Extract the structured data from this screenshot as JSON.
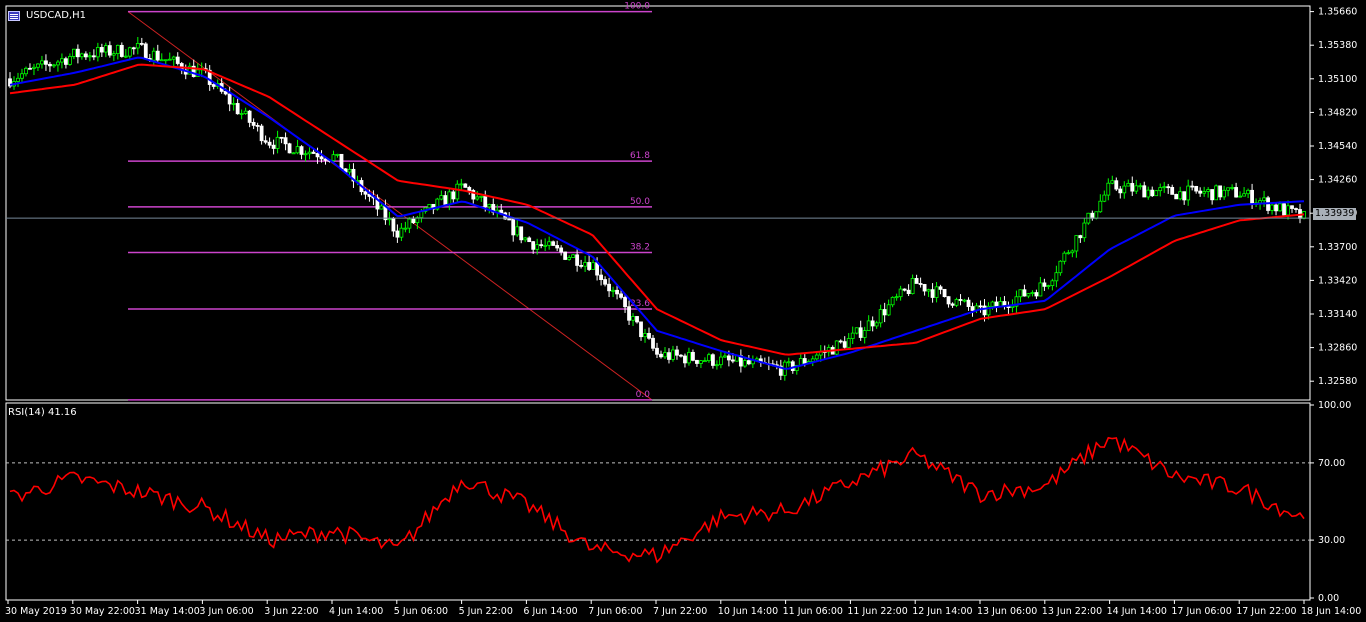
{
  "window": {
    "symbol_label": "USDCAD,H1",
    "current_price": "1.33939"
  },
  "colors": {
    "background": "#000000",
    "frame": "#ffffff",
    "candle_up": "#00ff00",
    "candle_down": "#ffffff",
    "ma_fast": "#0000ff",
    "ma_slow": "#ff0000",
    "fib": "#cc44cc",
    "rsi": "#ff0000",
    "bid_line": "#778899"
  },
  "price_axis": {
    "ticks": [
      "1.35660",
      "1.35380",
      "1.35100",
      "1.34820",
      "1.34540",
      "1.34260",
      "1.33980",
      "1.33700",
      "1.33420",
      "1.33140",
      "1.32860",
      "1.32580"
    ]
  },
  "time_axis": {
    "ticks": [
      "30 May 2019",
      "30 May 22:00",
      "31 May 14:00",
      "3 Jun 06:00",
      "3 Jun 22:00",
      "4 Jun 14:00",
      "5 Jun 06:00",
      "5 Jun 22:00",
      "6 Jun 14:00",
      "7 Jun 06:00",
      "7 Jun 22:00",
      "10 Jun 14:00",
      "11 Jun 06:00",
      "11 Jun 22:00",
      "12 Jun 14:00",
      "13 Jun 06:00",
      "13 Jun 22:00",
      "14 Jun 14:00",
      "17 Jun 06:00",
      "17 Jun 22:00",
      "18 Jun 14:00"
    ]
  },
  "fibonacci": {
    "levels": [
      {
        "label": "100.0",
        "price": 1.3566
      },
      {
        "label": "61.8",
        "price": 1.34414
      },
      {
        "label": "50.0",
        "price": 1.34033
      },
      {
        "label": "38.2",
        "price": 1.33653
      },
      {
        "label": "23.6",
        "price": 1.33182
      },
      {
        "label": "0.0",
        "price": 1.32424
      }
    ]
  },
  "rsi": {
    "title": "RSI(14) 41.16",
    "axis_ticks": [
      "100.00",
      "70.00",
      "30.00",
      "0.00"
    ],
    "levels": [
      70,
      30
    ]
  },
  "chart_data": [
    {
      "type": "candlestick",
      "symbol": "USDCAD",
      "timeframe": "H1",
      "ylim": [
        1.3244,
        1.3569
      ],
      "x": [
        "30 May 2019",
        "30 May 22:00",
        "31 May 14:00",
        "3 Jun 06:00",
        "3 Jun 22:00",
        "4 Jun 14:00",
        "5 Jun 06:00",
        "5 Jun 22:00",
        "6 Jun 14:00",
        "7 Jun 06:00",
        "7 Jun 22:00",
        "10 Jun 14:00",
        "11 Jun 06:00",
        "11 Jun 22:00",
        "12 Jun 14:00",
        "13 Jun 06:00",
        "13 Jun 22:00",
        "14 Jun 14:00",
        "17 Jun 06:00",
        "17 Jun 22:00",
        "18 Jun 14:00"
      ],
      "close_approx": [
        1.351,
        1.353,
        1.3535,
        1.3513,
        1.3458,
        1.3445,
        1.3382,
        1.342,
        1.3375,
        1.3356,
        1.328,
        1.3275,
        1.3268,
        1.3293,
        1.334,
        1.3315,
        1.3338,
        1.342,
        1.3415,
        1.3415,
        1.3394
      ],
      "series": [
        {
          "name": "MA fast",
          "values": [
            1.3505,
            1.3515,
            1.3528,
            1.3512,
            1.3478,
            1.344,
            1.3395,
            1.3408,
            1.339,
            1.3362,
            1.33,
            1.3283,
            1.3268,
            1.3282,
            1.33,
            1.3318,
            1.3325,
            1.3368,
            1.3396,
            1.3405,
            1.3408
          ]
        },
        {
          "name": "MA slow",
          "values": [
            1.3498,
            1.3505,
            1.3522,
            1.3518,
            1.3495,
            1.346,
            1.3425,
            1.3417,
            1.3405,
            1.338,
            1.3318,
            1.3292,
            1.328,
            1.3285,
            1.329,
            1.331,
            1.3318,
            1.3345,
            1.3375,
            1.3392,
            1.3397
          ]
        }
      ]
    },
    {
      "type": "line",
      "title": "RSI(14) 41.16",
      "ylim": [
        0,
        100
      ],
      "x": [
        "30 May 2019",
        "30 May 22:00",
        "31 May 14:00",
        "3 Jun 06:00",
        "3 Jun 22:00",
        "4 Jun 14:00",
        "5 Jun 06:00",
        "5 Jun 22:00",
        "6 Jun 14:00",
        "7 Jun 06:00",
        "7 Jun 22:00",
        "10 Jun 14:00",
        "11 Jun 06:00",
        "11 Jun 22:00",
        "12 Jun 14:00",
        "13 Jun 06:00",
        "13 Jun 22:00",
        "14 Jun 14:00",
        "17 Jun 06:00",
        "17 Jun 22:00",
        "18 Jun 14:00"
      ],
      "values": [
        52,
        62,
        55,
        47,
        30,
        35,
        25,
        62,
        48,
        25,
        22,
        42,
        45,
        60,
        74,
        54,
        58,
        83,
        63,
        57,
        41.16
      ]
    }
  ]
}
